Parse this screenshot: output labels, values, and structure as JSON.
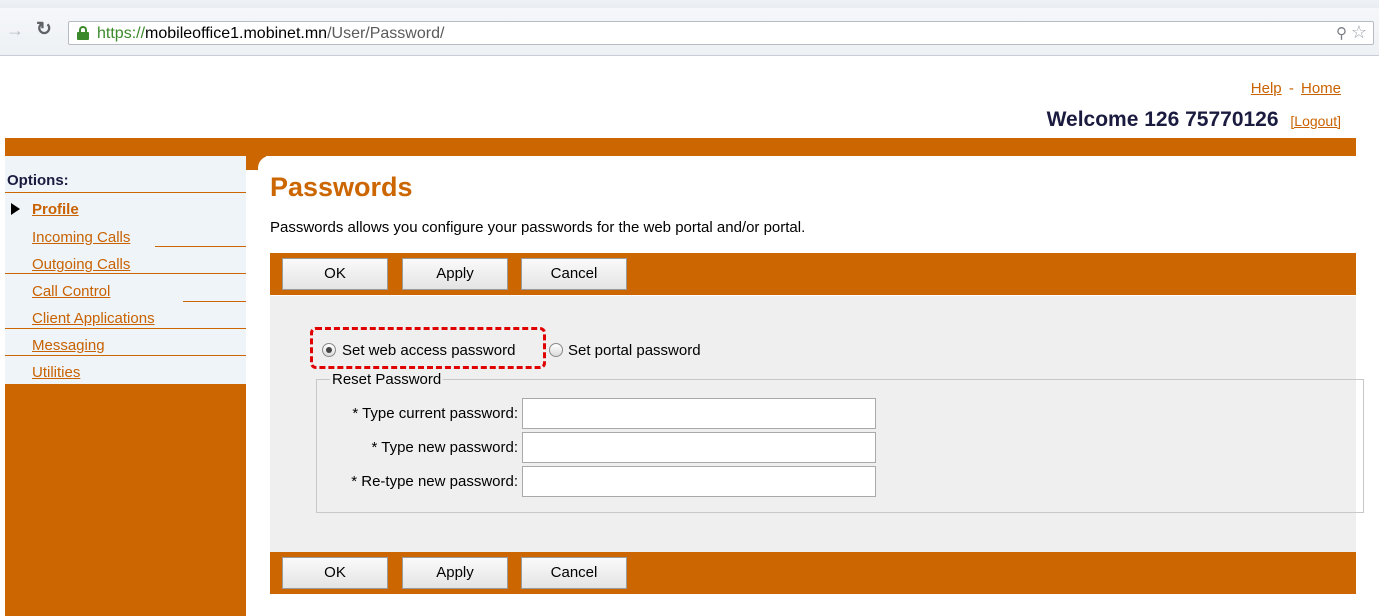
{
  "browser": {
    "url_protocol": "https://",
    "url_host": "mobileoffice1.mobinet.mn",
    "url_path": "/User/Password/"
  },
  "header": {
    "help_link": "Help",
    "separator": "-",
    "home_link": "Home",
    "welcome_text": "Welcome 126 75770126",
    "logout_link": "[Logout]"
  },
  "sidebar": {
    "title": "Options:",
    "items": [
      {
        "label": "Profile"
      },
      {
        "label": "Incoming Calls"
      },
      {
        "label": "Outgoing Calls"
      },
      {
        "label": "Call Control"
      },
      {
        "label": "Client Applications"
      },
      {
        "label": "Messaging"
      },
      {
        "label": "Utilities"
      }
    ]
  },
  "main": {
    "title": "Passwords",
    "description": "Passwords allows you configure your passwords for the web portal and/or portal.",
    "buttons": {
      "ok": "OK",
      "apply": "Apply",
      "cancel": "Cancel"
    },
    "radio_web": "Set web access password",
    "radio_portal": "Set portal password",
    "fieldset_legend": "Reset Password",
    "fields": {
      "current": "* Type current password:",
      "new": "* Type new password:",
      "retype": "* Re-type new password:"
    }
  },
  "colors": {
    "accent": "#cc6600",
    "highlight": "#e00000"
  }
}
